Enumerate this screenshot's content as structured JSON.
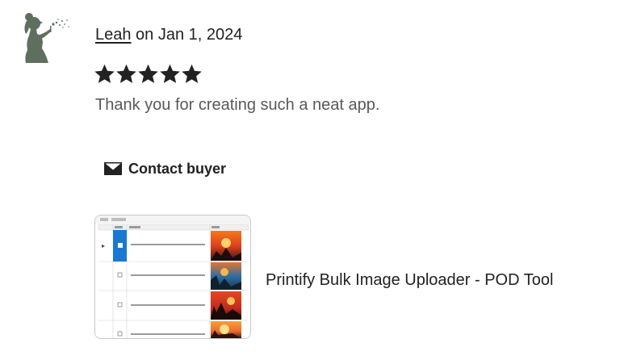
{
  "review": {
    "reviewer_name": "Leah",
    "date_text": " on Jan 1, 2024",
    "rating": 5,
    "rating_max": 5,
    "text": "Thank you for creating such a neat app."
  },
  "actions": {
    "contact_buyer_label": "Contact buyer"
  },
  "product": {
    "title": "Printify Bulk Image Uploader - POD Tool"
  },
  "colors": {
    "avatar": "#5f6f5f",
    "star": "#222222",
    "secondary_text": "#595959",
    "selection_blue": "#1a78d2"
  },
  "icons": {
    "avatar": "girl-blowing-dandelion-silhouette",
    "star": "star-filled-icon",
    "contact": "envelope-icon"
  }
}
